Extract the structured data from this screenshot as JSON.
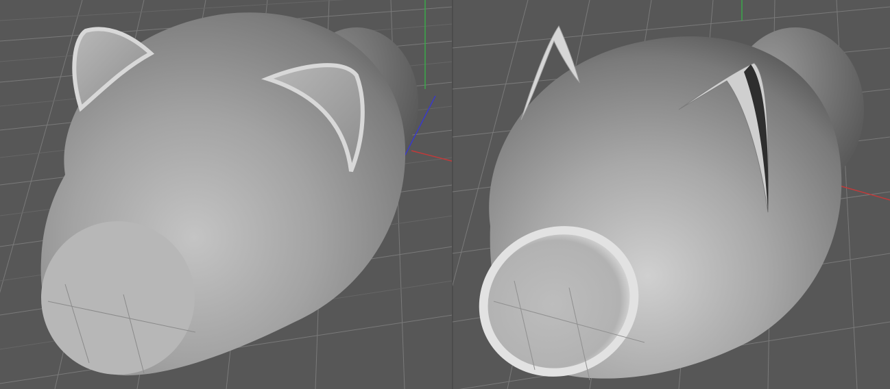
{
  "scene": {
    "background_color": "#575757",
    "grid_color": "#7a7a7a",
    "grid_major_color": "#6a6a6a",
    "axis_colors": {
      "x": "#c23a3a",
      "y": "#3aa84a",
      "z": "#3a3ac8"
    }
  },
  "viewports": [
    {
      "id": "left",
      "object": "pig-body-with-thick-ears",
      "shading": "smooth-gray"
    },
    {
      "id": "right",
      "object": "pig-body-with-thin-ears",
      "shading": "smooth-gray"
    }
  ]
}
